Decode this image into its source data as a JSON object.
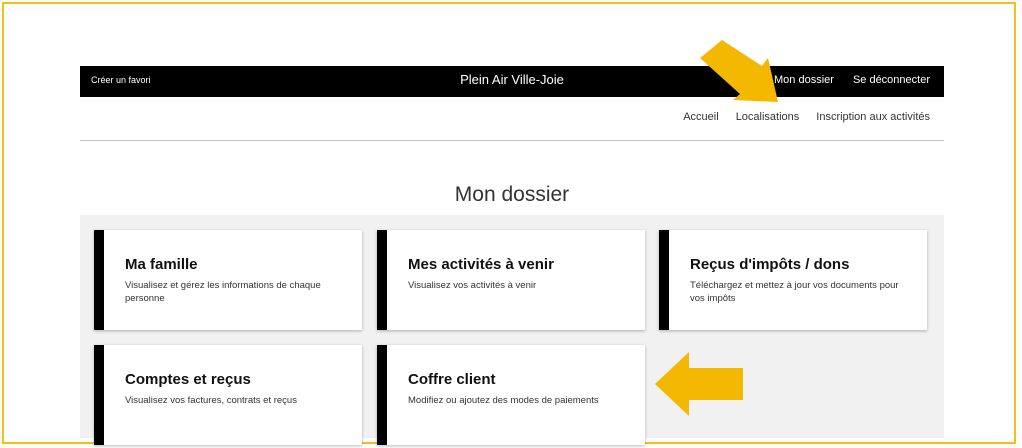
{
  "topbar": {
    "favorite_label": "Créer un favori",
    "brand": "Plein Air Ville-Joie",
    "my_account": "Mon dossier",
    "logout": "Se déconnecter"
  },
  "nav": {
    "items": [
      "Accueil",
      "Localisations",
      "Inscription aux activités"
    ]
  },
  "page": {
    "title": "Mon dossier"
  },
  "cards": [
    {
      "title": "Ma famille",
      "description": "Visualisez et gérez les informations de chaque personne"
    },
    {
      "title": "Mes activités à venir",
      "description": "Visualisez vos activités à venir"
    },
    {
      "title": "Reçus d'impôts / dons",
      "description": "Téléchargez et mettez à jour vos documents pour vos impôts"
    },
    {
      "title": "Comptes et reçus",
      "description": "Visualisez vos factures, contrats et reçus"
    },
    {
      "title": "Coffre client",
      "description": "Modifiez ou ajoutez des modes de paiements"
    }
  ],
  "colors": {
    "frame": "#f5bf19",
    "arrow": "#f5b800",
    "topbar": "#000000",
    "panel": "#f1f1f1"
  },
  "icons": [
    "arrow-down-left-icon",
    "arrow-left-icon"
  ]
}
